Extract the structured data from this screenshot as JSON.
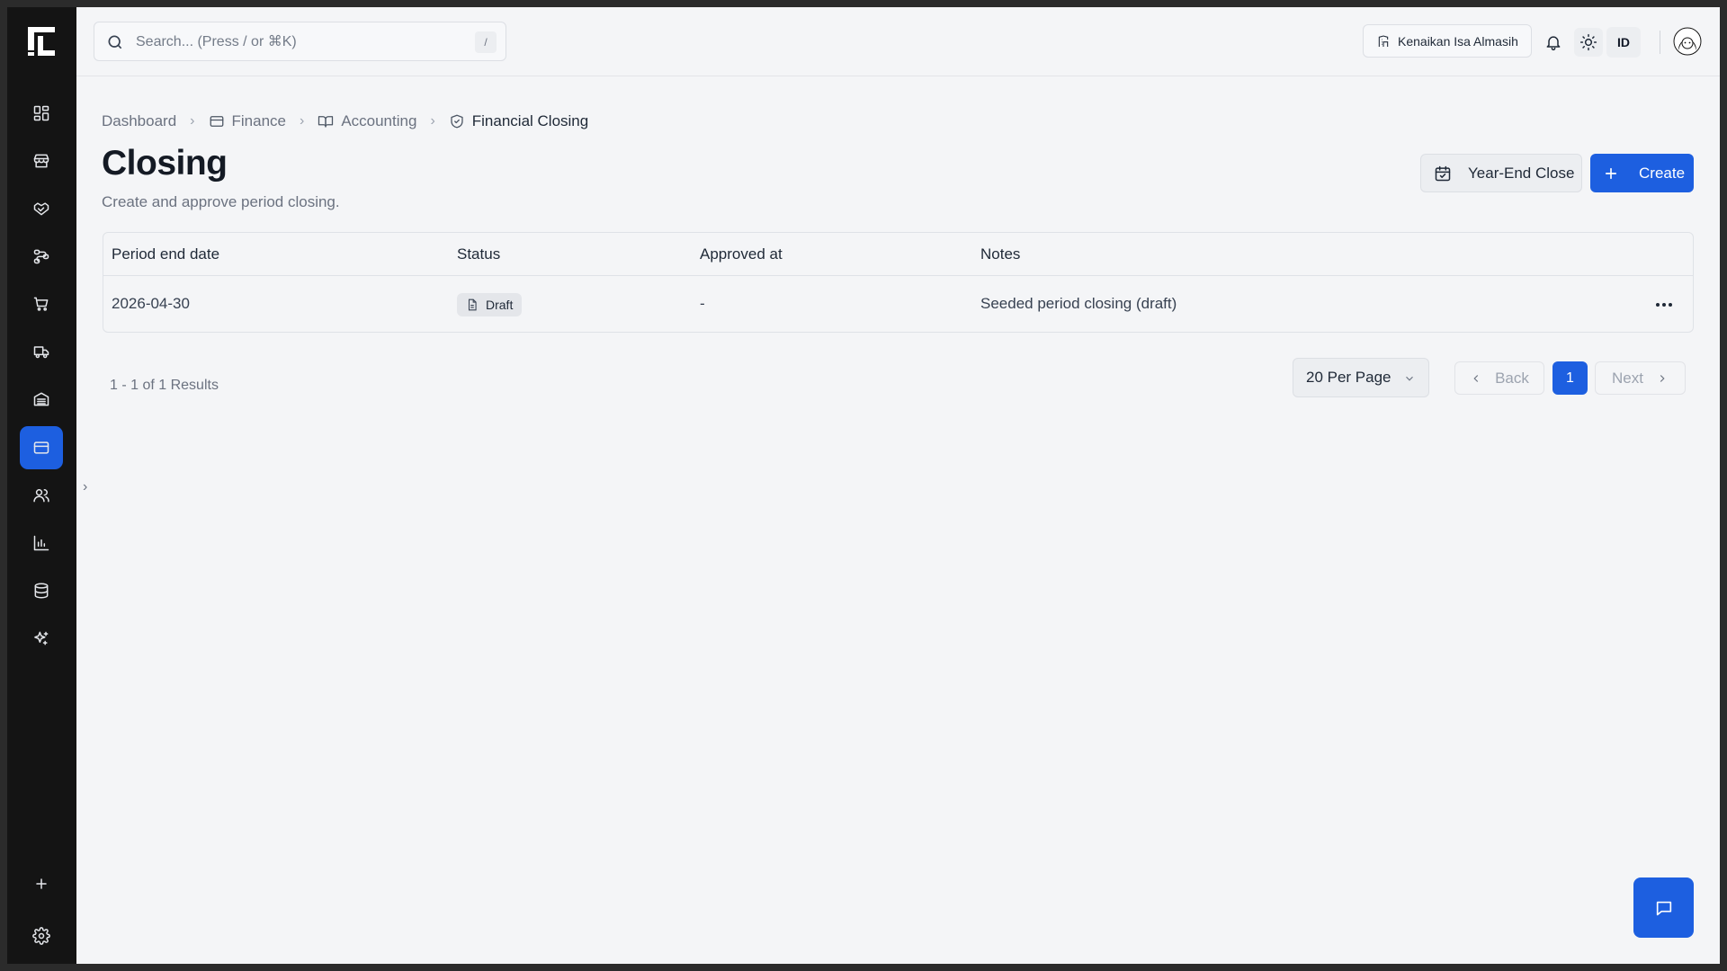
{
  "header": {
    "search_placeholder": "Search... (Press / or ⌘K)",
    "search_shortcut": "/",
    "organization": "Kenaikan Isa Almasih",
    "language": "ID"
  },
  "breadcrumb": {
    "items": [
      {
        "label": "Dashboard",
        "icon": "none"
      },
      {
        "label": "Finance",
        "icon": "credit-card-icon"
      },
      {
        "label": "Accounting",
        "icon": "book-open-icon"
      },
      {
        "label": "Financial Closing",
        "icon": "shield-check-icon"
      }
    ]
  },
  "page": {
    "title": "Closing",
    "subtitle": "Create and approve period closing.",
    "year_end_label": "Year-End Close",
    "create_label": "Create"
  },
  "table": {
    "columns": [
      "Period end date",
      "Status",
      "Approved at",
      "Notes"
    ],
    "rows": [
      {
        "period_end_date": "2026-04-30",
        "status": "Draft",
        "approved_at": "-",
        "notes": "Seeded period closing (draft)"
      }
    ]
  },
  "pagination": {
    "results_text": "1 - 1 of 1 Results",
    "per_page": "20 Per Page",
    "back_label": "Back",
    "current_page": "1",
    "next_label": "Next"
  },
  "sidebar": {
    "items": [
      "dashboard-grid-icon",
      "store-icon",
      "handshake-icon",
      "workflow-icon",
      "cart-icon",
      "truck-icon",
      "warehouse-icon",
      "credit-card-icon",
      "users-icon",
      "bar-chart-icon",
      "database-icon",
      "sparkles-icon"
    ],
    "active": "credit-card-icon"
  },
  "colors": {
    "accent": "#1d5fe0",
    "sidebar_bg": "#141414",
    "page_bg": "#f4f5f7"
  }
}
